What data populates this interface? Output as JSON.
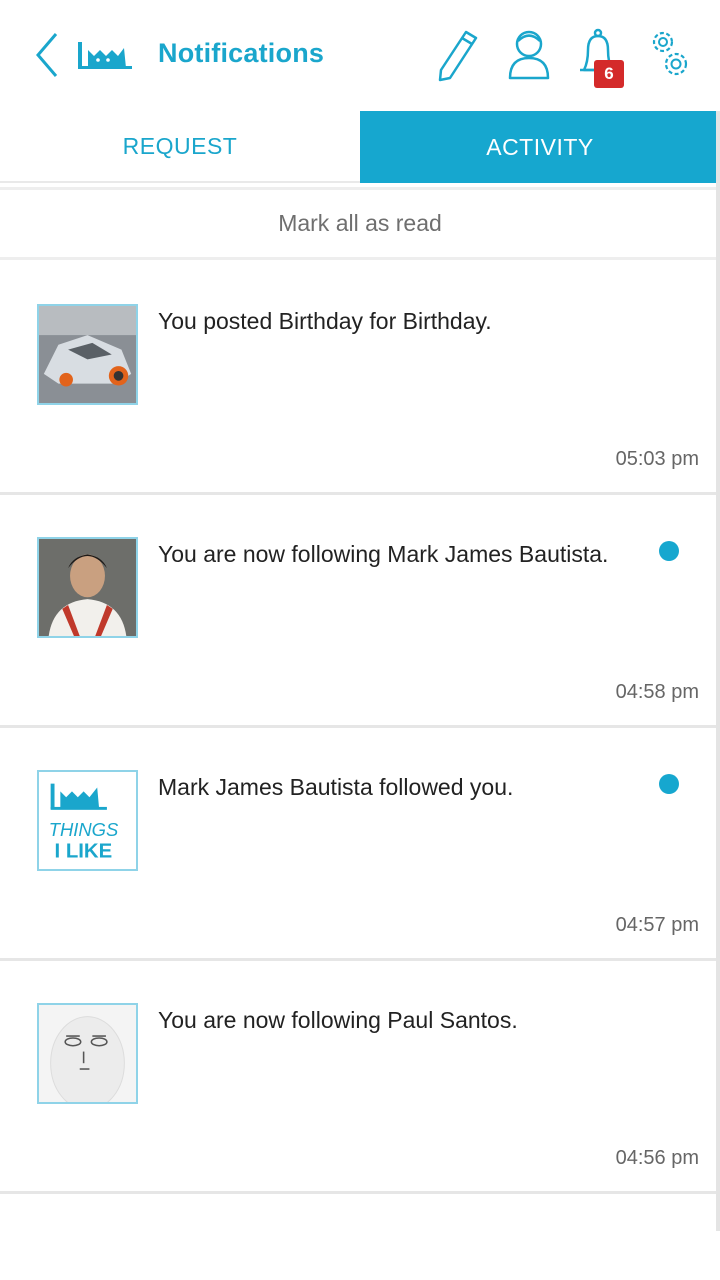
{
  "header": {
    "title": "Notifications",
    "notification_count": "6",
    "back_icon": "chevron-left-icon",
    "logo": "cat-logo",
    "edit_icon": "pencil-icon",
    "profile_icon": "user-icon",
    "notification_icon": "bell-icon",
    "settings_icon": "gears-icon"
  },
  "tabs": [
    {
      "label": "REQUEST",
      "active": false
    },
    {
      "label": "ACTIVITY",
      "active": true
    }
  ],
  "mark_all_label": "Mark all as read",
  "notifications": [
    {
      "text": "You posted Birthday for Birthday.",
      "time": "05:03 pm",
      "unread": false,
      "thumb": "car-photo"
    },
    {
      "text": "You are now following Mark James Bautista.",
      "time": "04:58 pm",
      "unread": true,
      "thumb": "portrait-photo"
    },
    {
      "text": "Mark James Bautista followed you.",
      "time": "04:57 pm",
      "unread": true,
      "thumb": "things-i-like-logo"
    },
    {
      "text": "You are now following Paul Santos.",
      "time": "04:56 pm",
      "unread": false,
      "thumb": "egg-face-avatar"
    }
  ],
  "logo_text": {
    "line1": "THINGS",
    "line2": "I LIKE"
  },
  "colors": {
    "accent": "#16a7cf",
    "badge": "#d42a2a",
    "text": "#222222",
    "muted": "#666666"
  }
}
